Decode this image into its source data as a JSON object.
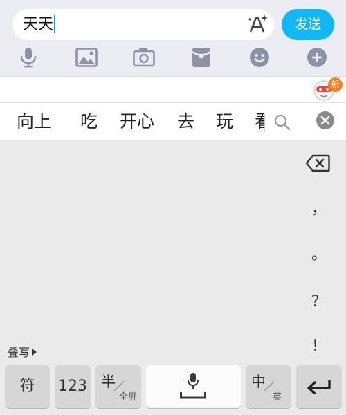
{
  "chat": {
    "input_value": "天天",
    "send_label": "发送",
    "tools": [
      "microphone-icon",
      "image-icon",
      "camera-icon",
      "red-packet-icon",
      "emoji-icon",
      "plus-icon"
    ],
    "accent": "#12b7f5"
  },
  "strip": {
    "badge": "新"
  },
  "candidates": {
    "items": [
      "向上",
      "吃",
      "开心",
      "去",
      "玩",
      "看"
    ]
  },
  "keyboard": {
    "punctuation": [
      "，",
      "。",
      "？",
      "！"
    ],
    "stack_label": "叠写",
    "keys": {
      "symbol": "符",
      "number": "123",
      "half_big": "半",
      "half_small": "全屏",
      "chinese_big": "中",
      "chinese_small": "英"
    }
  }
}
